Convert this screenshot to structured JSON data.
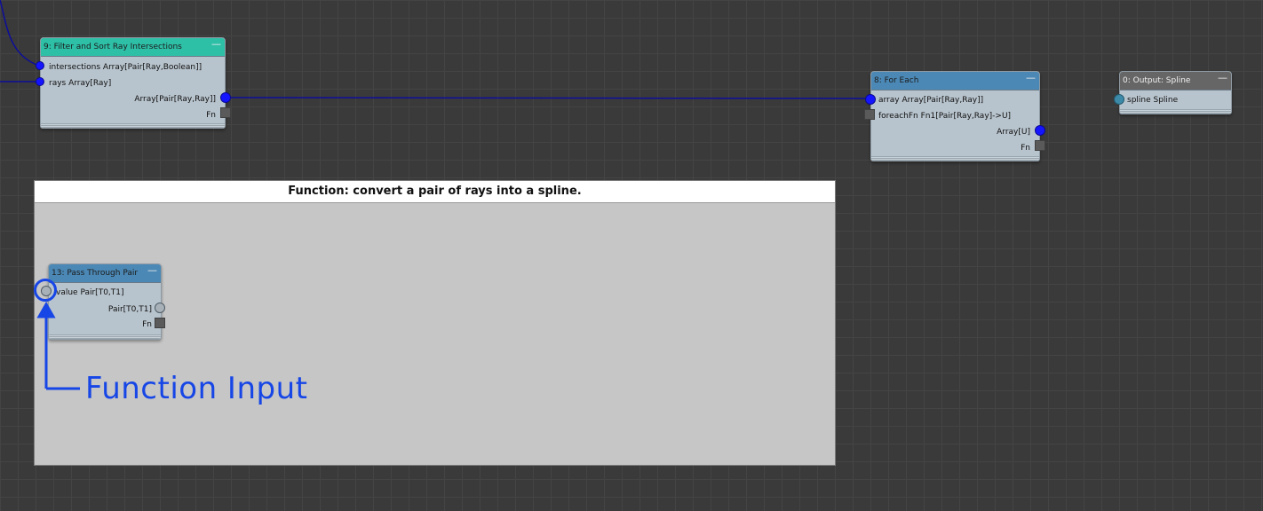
{
  "nodes": {
    "filter": {
      "title": "9: Filter and Sort Ray Intersections",
      "inputs": [
        "intersections Array[Pair[Ray,Boolean]]",
        "rays Array[Ray]"
      ],
      "outputs": [
        "Array[Pair[Ray,Ray]]",
        "Fn"
      ],
      "header_color": "#2ebfa7"
    },
    "foreach": {
      "title": "8: For Each",
      "inputs": [
        "array Array[Pair[Ray,Ray]]",
        "foreachFn Fn1[Pair[Ray,Ray]->U]"
      ],
      "outputs": [
        "Array[U]",
        "Fn"
      ],
      "header_color": "#4b88b5"
    },
    "output": {
      "title": "0: Output: Spline",
      "inputs": [
        "spline Spline"
      ],
      "header_color": "#666666"
    },
    "passthrough": {
      "title": "13: Pass Through Pair",
      "inputs": [
        "value Pair[T0,T1]"
      ],
      "outputs": [
        "Pair[T0,T1]",
        "Fn"
      ],
      "header_color": "#4b88b5"
    }
  },
  "minimize_glyph": "—",
  "group": {
    "title": "Function: convert a pair of rays into a spline."
  },
  "annotation": {
    "label": "Function Input",
    "color": "#1746e6"
  },
  "wire_color": "#0d0d9a"
}
